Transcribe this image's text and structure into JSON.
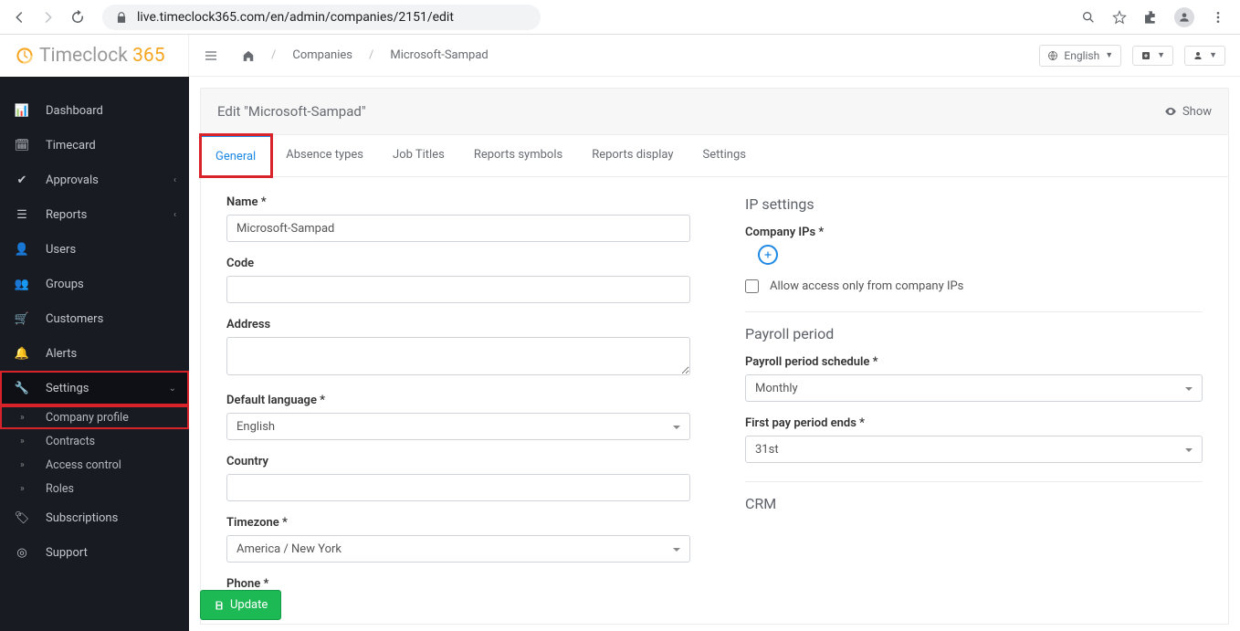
{
  "browser": {
    "url": "live.timeclock365.com/en/admin/companies/2151/edit"
  },
  "logo": {
    "text1": "Timeclock ",
    "text2": "365"
  },
  "sidebar": {
    "items": [
      {
        "label": "Dashboard"
      },
      {
        "label": "Timecard"
      },
      {
        "label": "Approvals",
        "caret": true
      },
      {
        "label": "Reports",
        "caret": true
      },
      {
        "label": "Users"
      },
      {
        "label": "Groups"
      },
      {
        "label": "Customers"
      },
      {
        "label": "Alerts"
      },
      {
        "label": "Settings",
        "caret": true,
        "expanded": true
      },
      {
        "label": "Subscriptions"
      },
      {
        "label": "Support"
      }
    ],
    "subs": [
      {
        "label": "Company profile"
      },
      {
        "label": "Contracts"
      },
      {
        "label": "Access control"
      },
      {
        "label": "Roles"
      }
    ]
  },
  "topbar": {
    "companies": "Companies",
    "current": "Microsoft-Sampad",
    "lang": "English"
  },
  "page": {
    "title": "Edit \"Microsoft-Sampad\"",
    "show": "Show"
  },
  "tabs": [
    "General",
    "Absence types",
    "Job Titles",
    "Reports symbols",
    "Reports display",
    "Settings"
  ],
  "form": {
    "name_label": "Name *",
    "name_value": "Microsoft-Sampad",
    "code_label": "Code",
    "address_label": "Address",
    "lang_label": "Default language *",
    "lang_value": "English",
    "country_label": "Country",
    "tz_label": "Timezone *",
    "tz_value": "America / New York",
    "phone_label": "Phone *"
  },
  "ip": {
    "heading": "IP settings",
    "label": "Company IPs *",
    "allow": "Allow access only from company IPs"
  },
  "payroll": {
    "heading": "Payroll period",
    "sched_label": "Payroll period schedule *",
    "sched_value": "Monthly",
    "first_label": "First pay period ends *",
    "first_value": "31st"
  },
  "crm": {
    "heading": "CRM"
  },
  "update": "Update"
}
